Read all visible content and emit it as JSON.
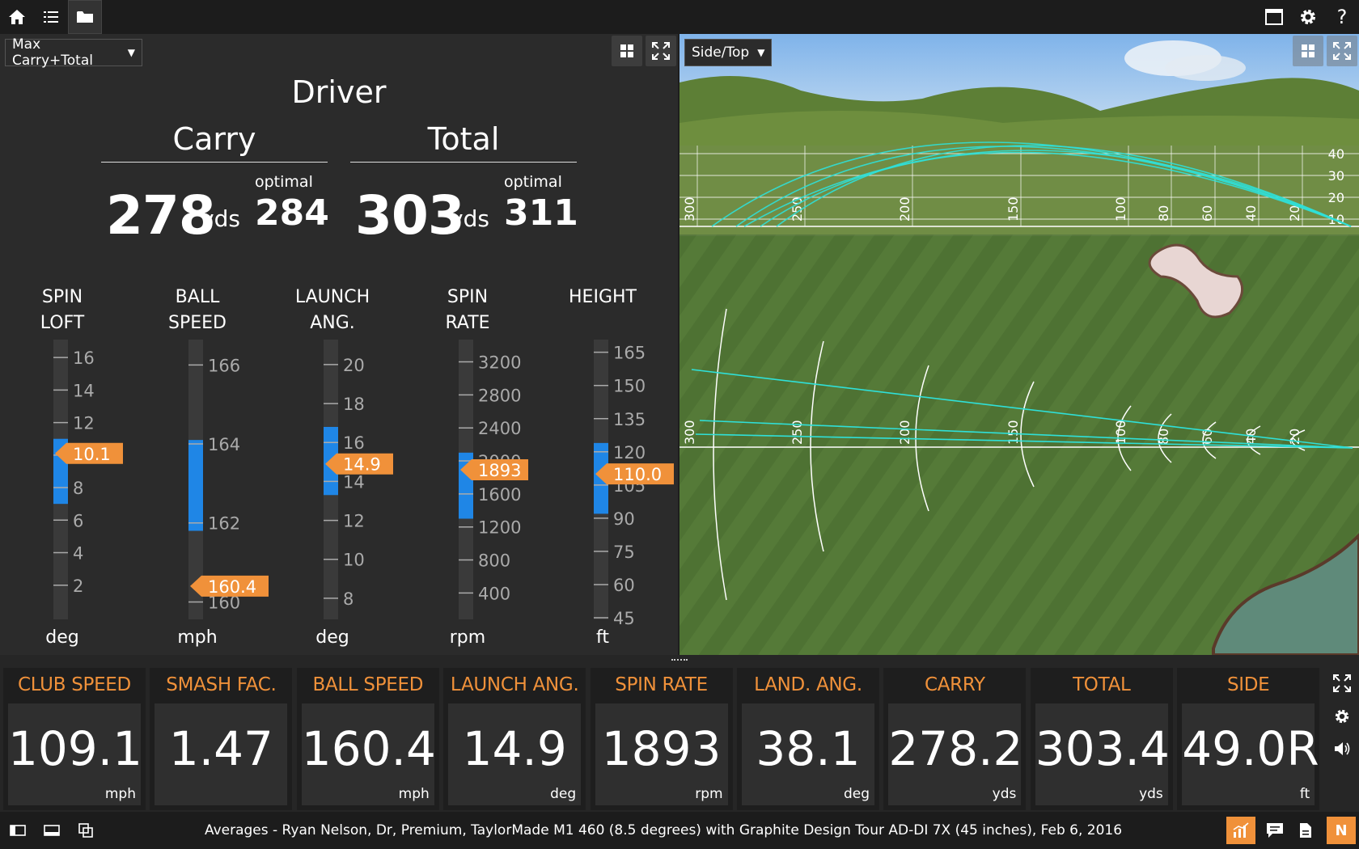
{
  "topbar": {
    "left_icons": [
      "home-icon",
      "list-icon",
      "folder-icon"
    ],
    "right_icons": [
      "window-icon",
      "gear-icon",
      "help-icon"
    ],
    "help_glyph": "?"
  },
  "left_panel": {
    "view_select": "Max Carry+Total",
    "club": "Driver",
    "carry": {
      "label": "Carry",
      "value": "278",
      "unit": "yds",
      "optimal_label": "optimal",
      "optimal": "284"
    },
    "total": {
      "label": "Total",
      "value": "303",
      "unit": "yds",
      "optimal_label": "optimal",
      "optimal": "311"
    },
    "gauges": [
      {
        "label1": "SPIN",
        "label2": "LOFT",
        "unit": "deg",
        "ticks": [
          "16",
          "14",
          "12",
          "10",
          "8",
          "6",
          "4",
          "2"
        ],
        "min": 0,
        "max": 17,
        "range_low": 7,
        "range_high": 11,
        "value": 10.1,
        "value_text": "10.1"
      },
      {
        "label1": "BALL",
        "label2": "SPEED",
        "unit": "mph",
        "ticks": [
          "166",
          "164",
          "162",
          "160"
        ],
        "min": 159.6,
        "max": 166.6,
        "range_low": 161.8,
        "range_high": 164.1,
        "value": 160.4,
        "value_text": "160.4"
      },
      {
        "label1": "LAUNCH",
        "label2": "ANG.",
        "unit": "deg",
        "ticks": [
          "20",
          "18",
          "16",
          "14",
          "12",
          "10",
          "8"
        ],
        "min": 7,
        "max": 21.2,
        "range_low": 13.3,
        "range_high": 16.8,
        "value": 14.9,
        "value_text": "14.9"
      },
      {
        "label1": "SPIN",
        "label2": "RATE",
        "unit": "rpm",
        "ticks": [
          "3200",
          "2800",
          "2400",
          "2000",
          "1600",
          "1200",
          "800",
          "400"
        ],
        "min": 100,
        "max": 3450,
        "range_low": 1300,
        "range_high": 2100,
        "value": 1893,
        "value_text": "1893"
      },
      {
        "label1": "HEIGHT",
        "label2": "",
        "unit": "ft",
        "ticks": [
          "165",
          "150",
          "135",
          "120",
          "105",
          "90",
          "75",
          "60",
          "45"
        ],
        "min": 45,
        "max": 170,
        "range_low": 92,
        "range_high": 124,
        "value": 110.0,
        "value_text": "110.0"
      }
    ]
  },
  "right_panel": {
    "view_select": "Side/Top",
    "side_distance_labels": [
      "300",
      "250",
      "200",
      "150",
      "100",
      "80",
      "60",
      "40",
      "20"
    ],
    "height_labels": [
      "40",
      "30",
      "20",
      "10"
    ],
    "top_distance_labels": [
      "300",
      "250",
      "200",
      "150",
      "100",
      "80",
      "60",
      "40",
      "20"
    ]
  },
  "tiles": [
    {
      "label": "CLUB SPEED",
      "value": "109.1",
      "unit": "mph"
    },
    {
      "label": "SMASH FAC.",
      "value": "1.47",
      "unit": ""
    },
    {
      "label": "BALL SPEED",
      "value": "160.4",
      "unit": "mph"
    },
    {
      "label": "LAUNCH ANG.",
      "value": "14.9",
      "unit": "deg"
    },
    {
      "label": "SPIN RATE",
      "value": "1893",
      "unit": "rpm"
    },
    {
      "label": "LAND. ANG.",
      "value": "38.1",
      "unit": "deg"
    },
    {
      "label": "CARRY",
      "value": "278.2",
      "unit": "yds"
    },
    {
      "label": "TOTAL",
      "value": "303.4",
      "unit": "yds"
    },
    {
      "label": "SIDE",
      "value": "49.0R",
      "unit": "ft"
    }
  ],
  "status": {
    "text": "Averages - Ryan Nelson, Dr, Premium, TaylorMade M1 460 (8.5 degrees) with Graphite Design Tour AD-DI 7X (45 inches), Feb 6, 2016",
    "logo_letter": "N"
  },
  "colors": {
    "accent": "#f0913a",
    "range_blue": "#1f86e6",
    "trace": "#2fe0d8"
  }
}
